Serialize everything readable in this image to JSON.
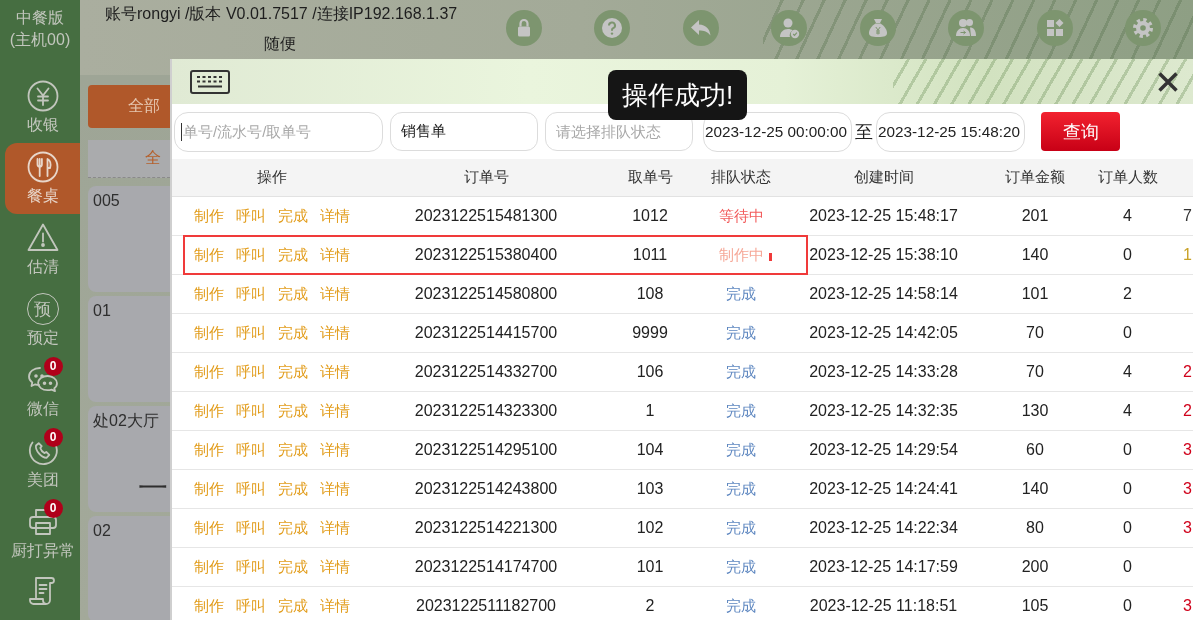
{
  "sidebar": {
    "title_lines": [
      "中餐版",
      "(主机00)"
    ],
    "items": [
      {
        "label": "收银",
        "selected": false
      },
      {
        "label": "餐桌",
        "selected": true
      },
      {
        "label": "估清",
        "selected": false
      },
      {
        "label": "预定",
        "icon_text": "预",
        "selected": false
      },
      {
        "label": "微信",
        "badge": "0",
        "selected": false
      },
      {
        "label": "美团",
        "badge": "0",
        "selected": false
      },
      {
        "label": "厨打异常",
        "badge": "0",
        "selected": false
      },
      {
        "selected": false
      }
    ]
  },
  "top_bar": {
    "account_info": "账号rongyi /版本 V0.01.7517 /连接IP192.168.1.37",
    "current_table": "随便"
  },
  "floor": {
    "filters": [
      {
        "label": "全部",
        "kind": "primary"
      },
      {
        "label": "全",
        "kind": "tab"
      }
    ],
    "tables": [
      {
        "name": "005"
      },
      {
        "name": "01"
      },
      {
        "name": "处02大厅",
        "caption": "一"
      },
      {
        "name": "02"
      }
    ]
  },
  "dialog": {
    "search": {
      "placeholder": "单号/流水号/取单号",
      "focused": true
    },
    "order_type": {
      "value": "销售单"
    },
    "queue_status": {
      "placeholder": "请选择排队状态"
    },
    "date_from": {
      "value": "2023-12-25 00:00:00"
    },
    "date_separator": "至",
    "date_to": {
      "value": "2023-12-25 15:48:20"
    },
    "query_button": "查询",
    "toast": {
      "message": "操作成功!"
    },
    "table": {
      "columns": [
        "操作",
        "订单号",
        "取单号",
        "排队状态",
        "创建时间",
        "订单金额",
        "订单人数"
      ],
      "rows": [
        {
          "actions": [
            "制作",
            "呼叫",
            "完成",
            "详情"
          ],
          "order_no": "2023122515481300",
          "ticket_no": "1012",
          "status": {
            "text": "等待中",
            "kind": "waiting"
          },
          "created_at": "2023-12-25 15:48:17",
          "amount": "201",
          "persons": "4",
          "column_8": {
            "text": "7",
            "color": "#333333"
          },
          "highlighted": false
        },
        {
          "actions": [
            "制作",
            "呼叫",
            "完成",
            "详情"
          ],
          "order_no": "2023122515380400",
          "ticket_no": "1011",
          "status": {
            "text": "制作中",
            "kind": "making"
          },
          "created_at": "2023-12-25 15:38:10",
          "amount": "140",
          "persons": "0",
          "column_8": {
            "text": "1",
            "color": "#c9a227"
          },
          "highlighted": true
        },
        {
          "actions": [
            "制作",
            "呼叫",
            "完成",
            "详情"
          ],
          "order_no": "2023122514580800",
          "ticket_no": "108",
          "status": {
            "text": "完成",
            "kind": "done"
          },
          "created_at": "2023-12-25 14:58:14",
          "amount": "101",
          "persons": "2",
          "highlighted": false
        },
        {
          "actions": [
            "制作",
            "呼叫",
            "完成",
            "详情"
          ],
          "order_no": "2023122514415700",
          "ticket_no": "9999",
          "status": {
            "text": "完成",
            "kind": "done"
          },
          "created_at": "2023-12-25 14:42:05",
          "amount": "70",
          "persons": "0",
          "highlighted": false
        },
        {
          "actions": [
            "制作",
            "呼叫",
            "完成",
            "详情"
          ],
          "order_no": "2023122514332700",
          "ticket_no": "106",
          "status": {
            "text": "完成",
            "kind": "done"
          },
          "created_at": "2023-12-25 14:33:28",
          "amount": "70",
          "persons": "4",
          "column_8": {
            "text": "2",
            "color": "#d0021b"
          },
          "highlighted": false
        },
        {
          "actions": [
            "制作",
            "呼叫",
            "完成",
            "详情"
          ],
          "order_no": "2023122514323300",
          "ticket_no": "1",
          "status": {
            "text": "完成",
            "kind": "done"
          },
          "created_at": "2023-12-25 14:32:35",
          "amount": "130",
          "persons": "4",
          "column_8": {
            "text": "2",
            "color": "#d0021b"
          },
          "highlighted": false
        },
        {
          "actions": [
            "制作",
            "呼叫",
            "完成",
            "详情"
          ],
          "order_no": "2023122514295100",
          "ticket_no": "104",
          "status": {
            "text": "完成",
            "kind": "done"
          },
          "created_at": "2023-12-25 14:29:54",
          "amount": "60",
          "persons": "0",
          "column_8": {
            "text": "3",
            "color": "#d0021b"
          },
          "highlighted": false
        },
        {
          "actions": [
            "制作",
            "呼叫",
            "完成",
            "详情"
          ],
          "order_no": "2023122514243800",
          "ticket_no": "103",
          "status": {
            "text": "完成",
            "kind": "done"
          },
          "created_at": "2023-12-25 14:24:41",
          "amount": "140",
          "persons": "0",
          "column_8": {
            "text": "3",
            "color": "#d0021b"
          },
          "highlighted": false
        },
        {
          "actions": [
            "制作",
            "呼叫",
            "完成",
            "详情"
          ],
          "order_no": "2023122514221300",
          "ticket_no": "102",
          "status": {
            "text": "完成",
            "kind": "done"
          },
          "created_at": "2023-12-25 14:22:34",
          "amount": "80",
          "persons": "0",
          "column_8": {
            "text": "3",
            "color": "#d0021b"
          },
          "highlighted": false
        },
        {
          "actions": [
            "制作",
            "呼叫",
            "完成",
            "详情"
          ],
          "order_no": "2023122514174700",
          "ticket_no": "101",
          "status": {
            "text": "完成",
            "kind": "done"
          },
          "created_at": "2023-12-25 14:17:59",
          "amount": "200",
          "persons": "0",
          "highlighted": false
        },
        {
          "actions": [
            "制作",
            "呼叫",
            "完成",
            "详情"
          ],
          "order_no": "2023122511182700",
          "ticket_no": "2",
          "status": {
            "text": "完成",
            "kind": "done"
          },
          "created_at": "2023-12-25 11:18:51",
          "amount": "105",
          "persons": "0",
          "column_8": {
            "text": "3",
            "color": "#d0021b"
          },
          "highlighted": false
        }
      ]
    }
  }
}
